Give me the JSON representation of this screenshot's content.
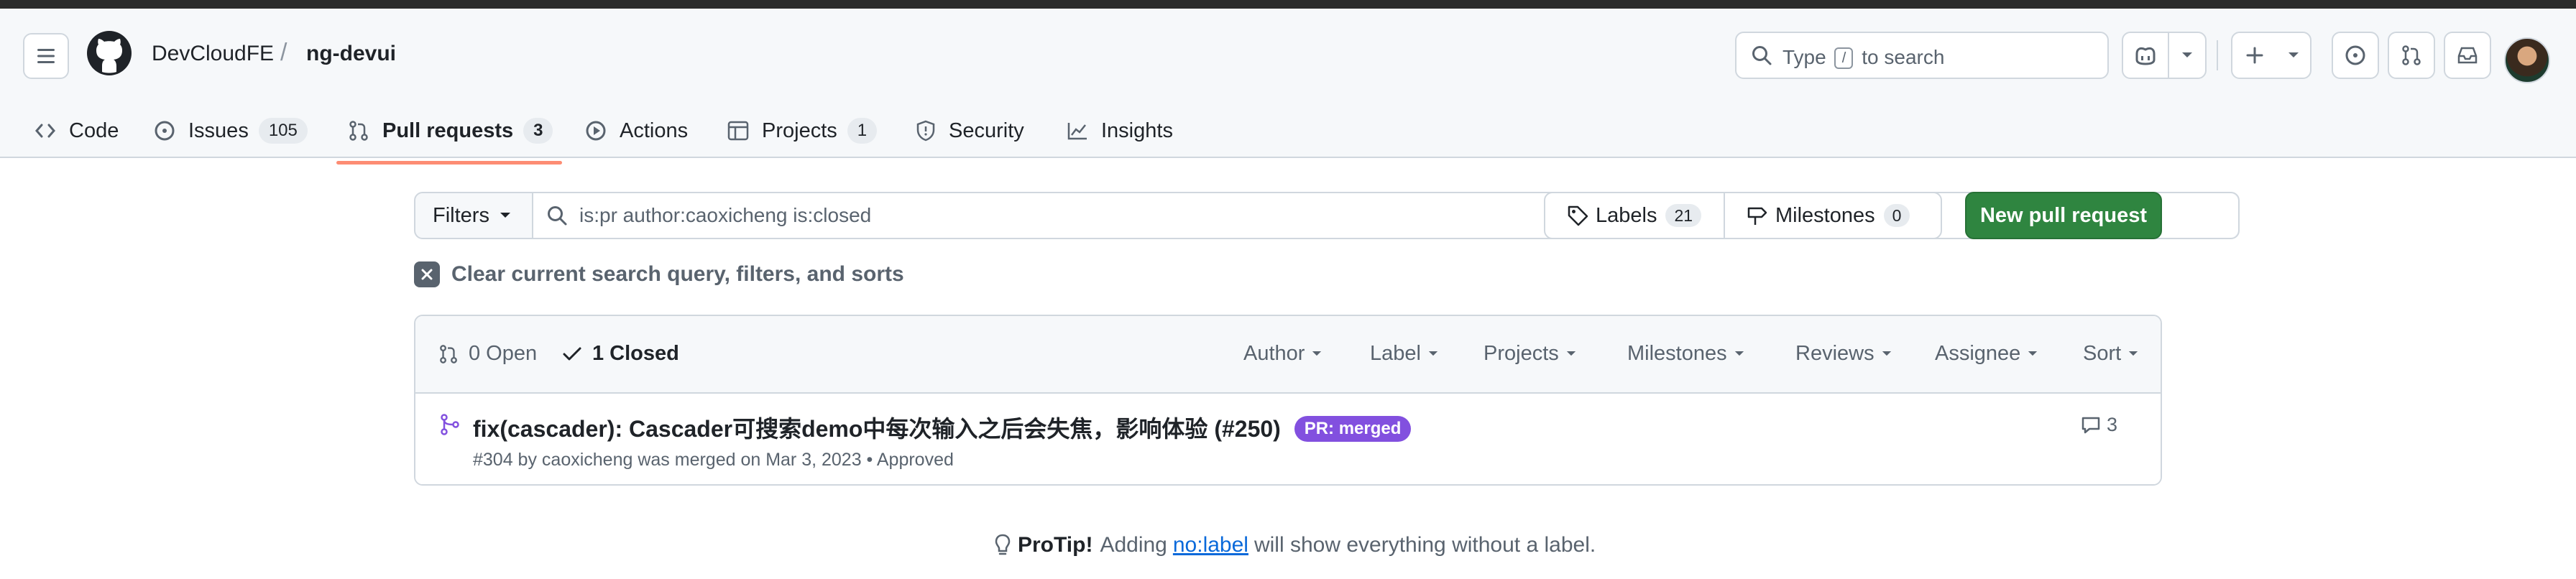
{
  "header": {
    "owner": "DevCloudFE",
    "separator": "/",
    "repo": "ng-devui",
    "search_prefix": "Type",
    "search_key": "/",
    "search_suffix": "to search"
  },
  "tabs": [
    {
      "label": "Code",
      "icon": "code-icon"
    },
    {
      "label": "Issues",
      "count": "105",
      "icon": "issue-icon"
    },
    {
      "label": "Pull requests",
      "count": "3",
      "icon": "pull-request-icon",
      "active": true
    },
    {
      "label": "Actions",
      "icon": "play-icon"
    },
    {
      "label": "Projects",
      "count": "1",
      "icon": "table-icon"
    },
    {
      "label": "Security",
      "icon": "shield-icon"
    },
    {
      "label": "Insights",
      "icon": "graph-icon"
    }
  ],
  "filters": {
    "button_label": "Filters",
    "query": "is:pr author:caoxicheng is:closed",
    "labels_label": "Labels",
    "labels_count": "21",
    "milestones_label": "Milestones",
    "milestones_count": "0",
    "new_pr_label": "New pull request",
    "clear_label": "Clear current search query, filters, and sorts"
  },
  "list": {
    "open_label": "0 Open",
    "closed_label": "1 Closed",
    "sort_menus": [
      "Author",
      "Label",
      "Projects",
      "Milestones",
      "Reviews",
      "Assignee",
      "Sort"
    ],
    "items": [
      {
        "title": "fix(cascader): Cascader可搜索demo中每次输入之后会失焦，影响体验 (#250)",
        "badge": "PR: merged",
        "meta": "#304 by caoxicheng was merged on Mar 3, 2023 • Approved",
        "comments": "3"
      }
    ]
  },
  "protip": {
    "prefix": "ProTip!",
    "before": "Adding",
    "link": "no:label",
    "after": "will show everything without a label."
  },
  "colors": {
    "accent_green": "#2f8540",
    "merged_purple": "#8250df",
    "tab_underline": "#fd8c73",
    "link_blue": "#0969da"
  }
}
